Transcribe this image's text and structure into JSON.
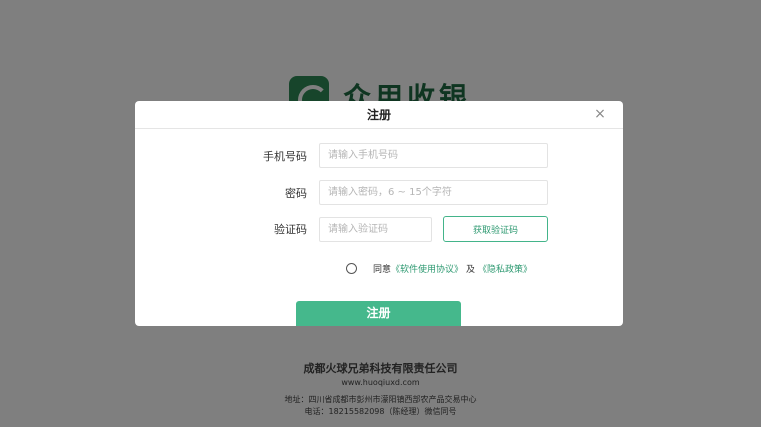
{
  "background": {
    "logo_text": "众用收银",
    "company": "成都火球兄弟科技有限责任公司",
    "website": "www.huoqiuxd.com",
    "address": "地址：四川省成都市彭州市濛阳镇西部农产品交易中心",
    "phone": "电话：18215582098（陈经理）微信同号"
  },
  "modal": {
    "title": "注册",
    "close_symbol": "×",
    "phone": {
      "label": "手机号码",
      "placeholder": "请输入手机号码",
      "value": ""
    },
    "password": {
      "label": "密码",
      "placeholder": "请输入密码，6 ~ 15个字符",
      "value": ""
    },
    "code": {
      "label": "验证码",
      "placeholder": "请输入验证码",
      "value": "",
      "button": "获取验证码"
    },
    "agree": {
      "prefix": "同意",
      "terms_link": "《软件使用协议》",
      "and": "及",
      "privacy_link": "《隐私政策》",
      "checked": false
    },
    "submit_label": "注册"
  },
  "colors": {
    "accent": "#45b88c",
    "link": "#2f9a72",
    "overlay": "rgba(0,0,0,0.5)"
  }
}
